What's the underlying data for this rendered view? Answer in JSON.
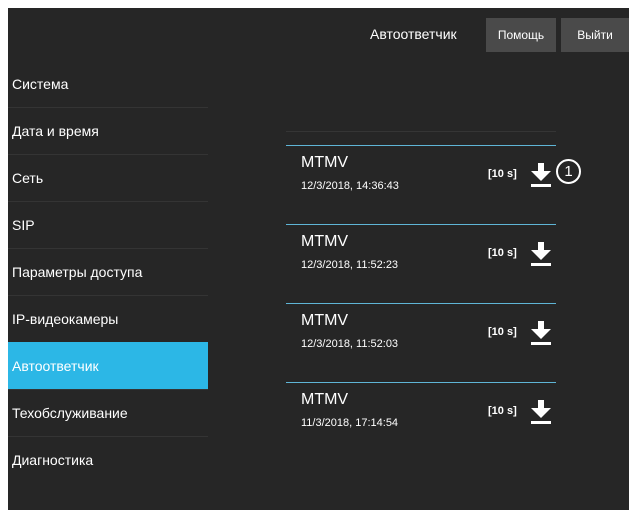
{
  "header": {
    "title": "Автоответчик",
    "help_label": "Помощь",
    "exit_label": "Выйти"
  },
  "sidebar": {
    "items": [
      {
        "label": "Система"
      },
      {
        "label": "Дата и время"
      },
      {
        "label": "Сеть"
      },
      {
        "label": "SIP"
      },
      {
        "label": "Параметры доступа"
      },
      {
        "label": "IP-видеокамеры"
      },
      {
        "label": "Автоответчик",
        "active": true
      },
      {
        "label": "Техобслуживание"
      },
      {
        "label": "Диагностика"
      }
    ]
  },
  "recordings": [
    {
      "name": "MTMV",
      "date": "12/3/2018, 14:36:43",
      "duration": "[10 s]"
    },
    {
      "name": "MTMV",
      "date": "12/3/2018, 11:52:23",
      "duration": "[10 s]"
    },
    {
      "name": "MTMV",
      "date": "12/3/2018, 11:52:03",
      "duration": "[10 s]"
    },
    {
      "name": "MTMV",
      "date": "11/3/2018, 17:14:54",
      "duration": "[10 s]"
    }
  ],
  "callout": "1",
  "colors": {
    "background": "#262626",
    "accent": "#2cb7e6",
    "button": "#4a4a4a",
    "separator": "#5fb5d6"
  },
  "icons": {
    "download": "download-icon"
  }
}
